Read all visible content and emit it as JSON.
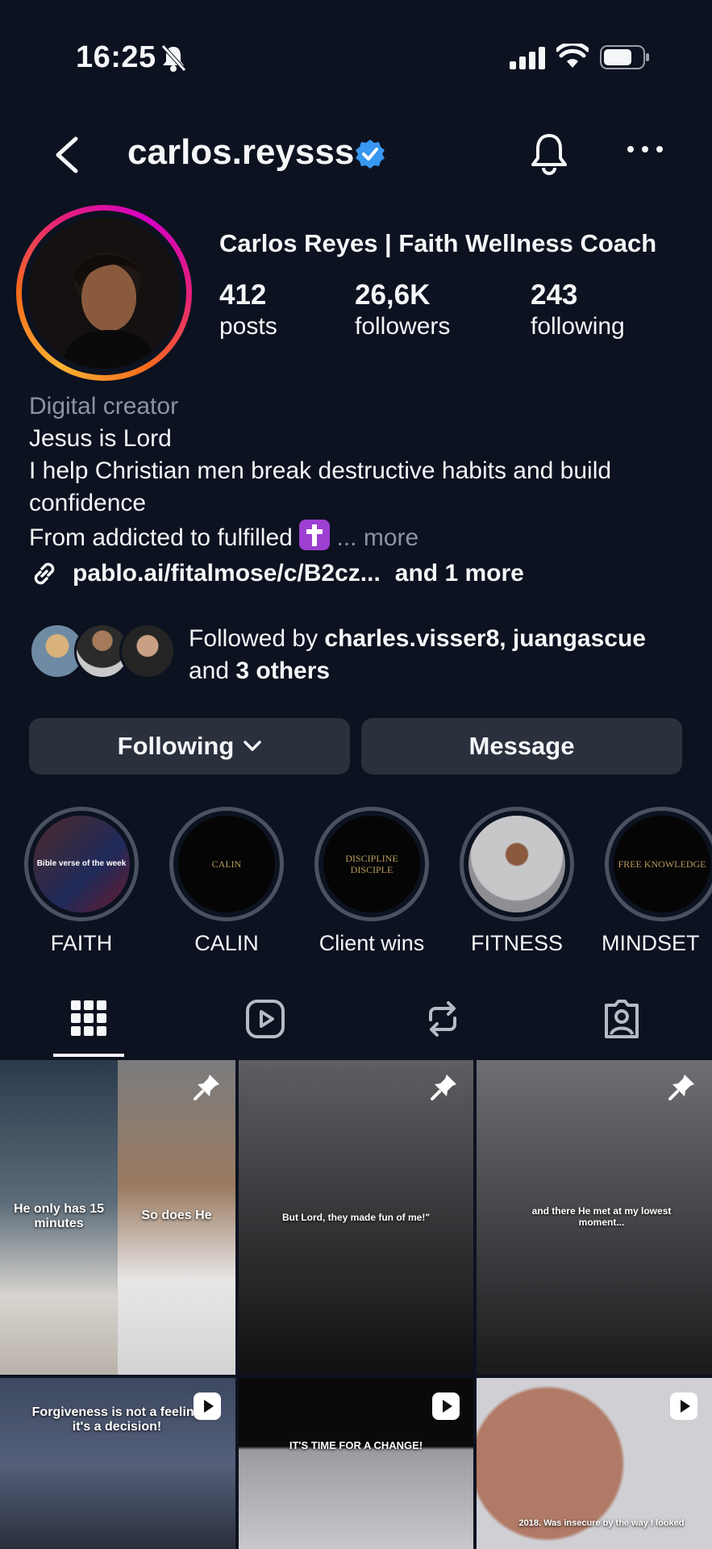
{
  "status_bar": {
    "time": "16:25"
  },
  "header": {
    "username": "carlos.reysss"
  },
  "profile": {
    "display_name": "Carlos Reyes | Faith Wellness Coach",
    "stats": [
      {
        "value": "412",
        "label": "posts"
      },
      {
        "value": "26,6K",
        "label": "followers"
      },
      {
        "value": "243",
        "label": "following"
      }
    ],
    "category": "Digital creator",
    "bio_lines": [
      "Jesus is Lord",
      "I help Christian men break destructive habits and build confidence",
      "From addicted to fulfilled"
    ],
    "bio_more": "... more",
    "link": "pablo.ai/fitalmose/c/B2cz...",
    "link_extra": "and 1 more",
    "followed_by_prefix": "Followed by ",
    "followed_by_names": "charles.visser8, juangascue",
    "followed_by_and": "and ",
    "followed_by_others": "3 others"
  },
  "actions": {
    "following": "Following",
    "message": "Message"
  },
  "highlights": [
    {
      "label": "FAITH",
      "cover_text": "Bible verse of the week"
    },
    {
      "label": "CALIN",
      "cover_text": "CALIN"
    },
    {
      "label": "Client wins",
      "cover_text": "DISCIPLINE DISCIPLE"
    },
    {
      "label": "FITNESS",
      "cover_text": ""
    },
    {
      "label": "MINDSET",
      "cover_text": "FREE KNOWLEDGE"
    }
  ],
  "grid": [
    {
      "caption_left": "He only has 15 minutes",
      "caption_right": "So does He",
      "pinned": true
    },
    {
      "caption": "But Lord, they made fun of me!\"",
      "pinned": true
    },
    {
      "caption": "and there He met at my lowest moment...",
      "pinned": true
    },
    {
      "caption": "Forgiveness is not a feeling it's a decision!",
      "reel": true
    },
    {
      "caption": "IT'S TIME FOR A CHANGE!",
      "reel": true
    },
    {
      "caption": "2018. Was insecure by the way I looked",
      "reel": true
    }
  ],
  "colors": {
    "background": "#0c1220",
    "button": "#2a313d",
    "verified": "#3897f0",
    "muted": "#8b93a2"
  }
}
